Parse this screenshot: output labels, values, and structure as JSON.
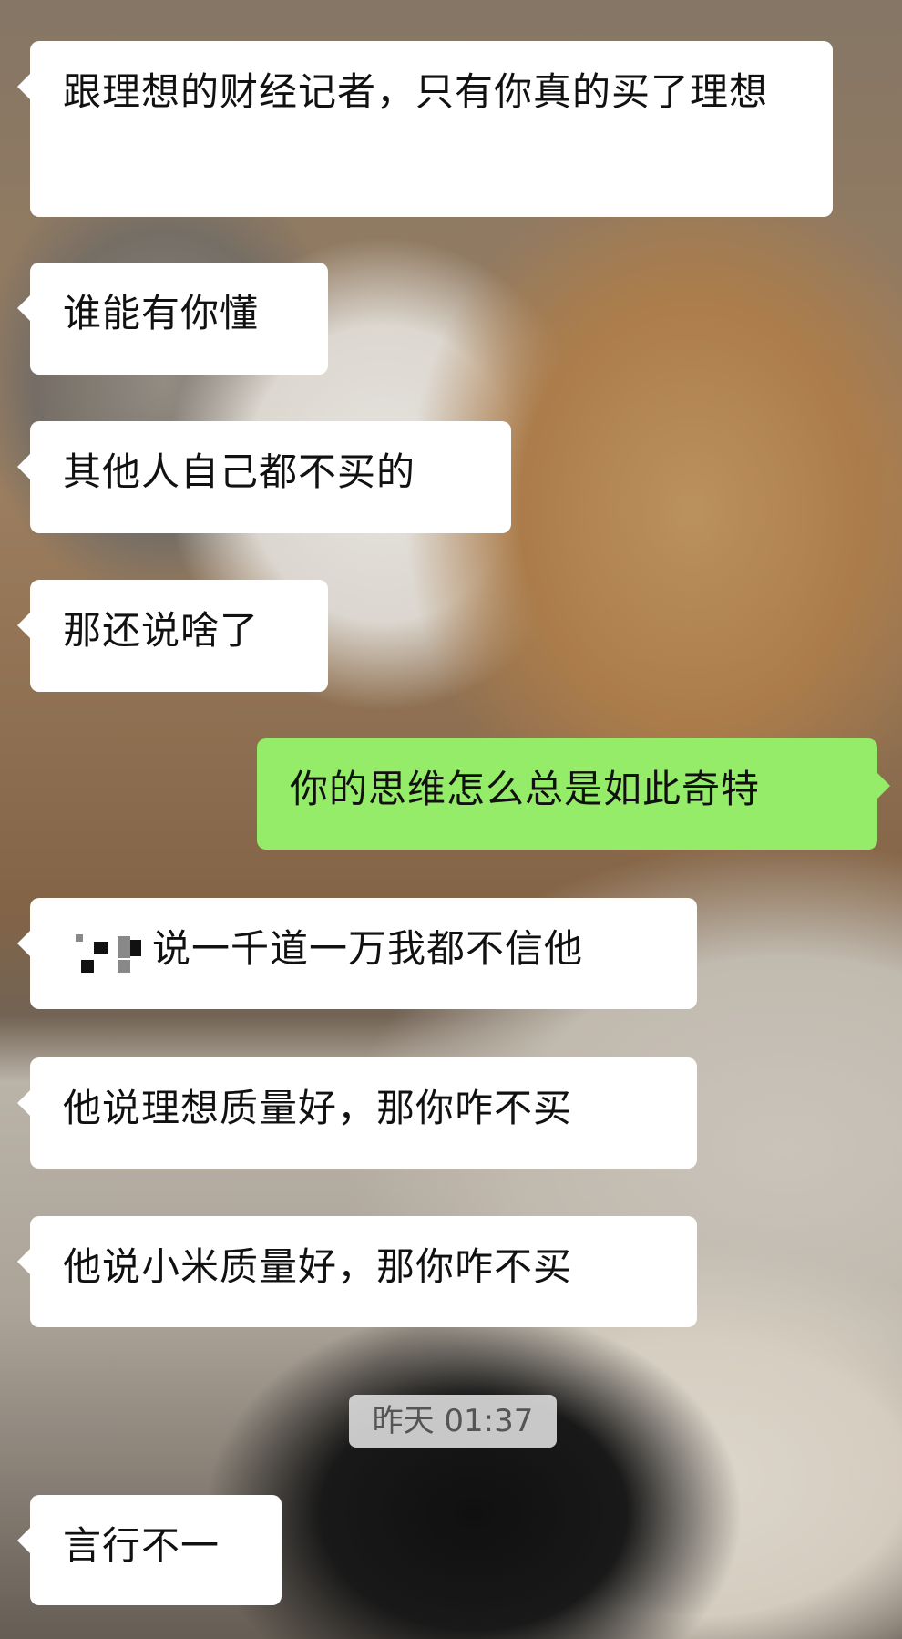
{
  "messages": [
    {
      "side": "left",
      "text": "跟理想的财经记者，只有你真的买了理想"
    },
    {
      "side": "left",
      "text": "谁能有你懂"
    },
    {
      "side": "left",
      "text": "其他人自己都不买的"
    },
    {
      "side": "left",
      "text": "那还说啥了"
    },
    {
      "side": "right",
      "text": "你的思维怎么总是如此奇特"
    },
    {
      "side": "left",
      "text": "说一千道一万我都不信他"
    },
    {
      "side": "left",
      "text": "他说理想质量好，那你咋不买"
    },
    {
      "side": "left",
      "text": "他说小米质量好，那你咋不买"
    },
    {
      "side": "left",
      "text": "言行不一"
    }
  ],
  "timestamp": "昨天 01:37",
  "colors": {
    "incoming_bubble": "#ffffff",
    "outgoing_bubble": "#95ec69",
    "text": "#111111"
  }
}
